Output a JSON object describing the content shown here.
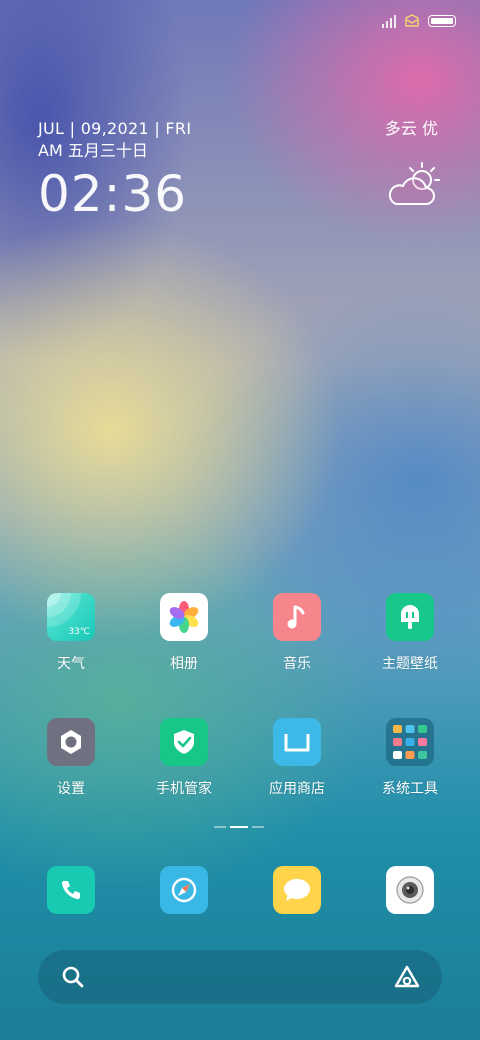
{
  "status_bar": {
    "icons": [
      "signal-icon",
      "sms-icon",
      "battery-icon"
    ]
  },
  "clock": {
    "date": "JUL | 09,2021 | FRI",
    "lunar": "AM  五月三十日",
    "time": "02:36"
  },
  "weather": {
    "text": "多云 优",
    "icon": "cloudy-sun-icon"
  },
  "apps_row1": [
    {
      "label": "天气",
      "icon": "weather-app-icon",
      "badge": "33℃",
      "color": "#29d6c7"
    },
    {
      "label": "相册",
      "icon": "gallery-app-icon",
      "color": "#ffffff"
    },
    {
      "label": "音乐",
      "icon": "music-app-icon",
      "color": "#f5818a"
    },
    {
      "label": "主题壁纸",
      "icon": "theme-app-icon",
      "color": "#19c68a"
    }
  ],
  "apps_row2": [
    {
      "label": "设置",
      "icon": "settings-app-icon",
      "color": "#6d6f7d"
    },
    {
      "label": "手机管家",
      "icon": "security-app-icon",
      "color": "#17c786"
    },
    {
      "label": "应用商店",
      "icon": "app-store-icon",
      "color": "#3bb8e6"
    },
    {
      "label": "系统工具",
      "icon": "system-tools-folder-icon",
      "color": "#2a7f98"
    }
  ],
  "dock": [
    {
      "icon": "phone-icon",
      "color": "#18c9b1"
    },
    {
      "icon": "browser-icon",
      "color": "#3ab7e4"
    },
    {
      "icon": "messages-icon",
      "color": "#ffd54a"
    },
    {
      "icon": "camera-icon",
      "color": "#ffffff"
    }
  ],
  "search": {
    "icons": [
      "search-icon",
      "assistant-icon"
    ]
  }
}
